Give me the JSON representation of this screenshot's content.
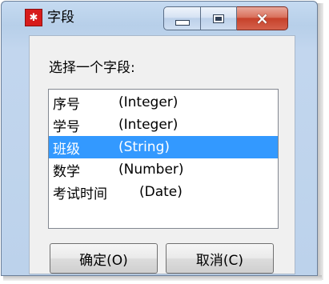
{
  "window": {
    "title": "字段",
    "icon": "app-logo-icon",
    "controls": {
      "minimize": "minimize-icon",
      "maximize": "maximize-icon",
      "close": "×"
    }
  },
  "dialog": {
    "prompt": "选择一个字段:",
    "fields": [
      {
        "name": "序号",
        "type": "(Integer)",
        "selected": false
      },
      {
        "name": "学号",
        "type": "(Integer)",
        "selected": false
      },
      {
        "name": "班级",
        "type": "(String)",
        "selected": true
      },
      {
        "name": "数学",
        "type": "(Number)",
        "selected": false
      },
      {
        "name": "考试时间",
        "type": "(Date)",
        "selected": false
      }
    ],
    "buttons": {
      "ok_label": "确定(O)",
      "cancel_label": "取消(C)"
    }
  },
  "colors": {
    "selection": "#3399ff",
    "close_button": "#c6412a",
    "icon_red": "#d71b1b"
  }
}
